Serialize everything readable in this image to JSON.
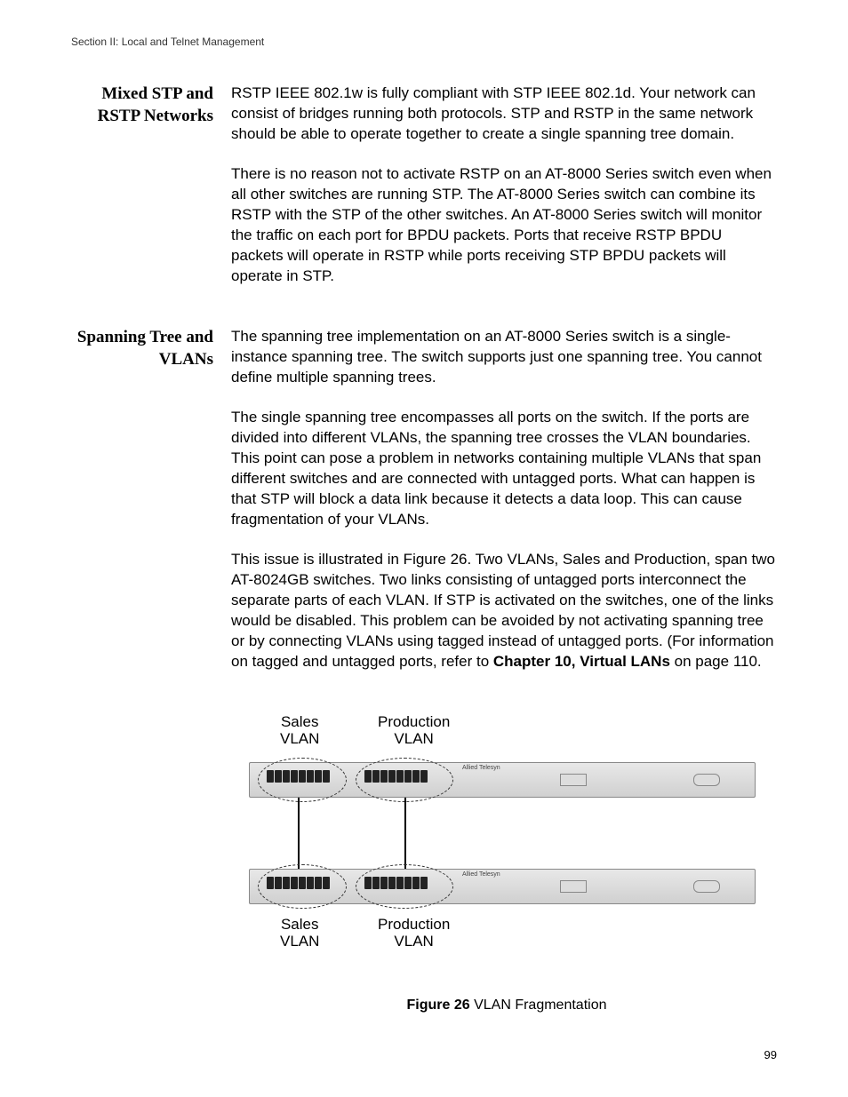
{
  "header": "Section II: Local and Telnet Management",
  "sections": [
    {
      "heading": "Mixed STP and RSTP Networks",
      "paragraphs": [
        "RSTP IEEE 802.1w is fully compliant with STP IEEE 802.1d. Your network can consist of bridges running both protocols. STP and RSTP in the same network should be able to operate together to create a single spanning tree domain.",
        "There is no reason not to activate RSTP on an AT-8000 Series switch even when all other switches are running STP. The AT-8000 Series switch can combine its RSTP with the STP of the other switches. An AT-8000 Series switch will monitor the traffic on each port for BPDU packets. Ports that receive RSTP BPDU packets will operate in RSTP while ports receiving STP BPDU packets will operate in STP."
      ]
    },
    {
      "heading": "Spanning Tree and VLANs",
      "paragraphs": [
        "The spanning tree implementation on an AT-8000 Series switch is a single-instance spanning tree. The switch supports just one spanning tree. You cannot define multiple spanning trees.",
        "The single spanning tree encompasses all ports on the switch. If the ports are divided into different VLANs, the spanning tree crosses the VLAN boundaries. This point can pose a problem in networks containing multiple VLANs that span different switches and are connected with untagged ports. What can happen is that STP will block a data link because it detects a data loop. This can cause fragmentation of your VLANs."
      ]
    }
  ],
  "para3_parts": {
    "pre": "This issue is illustrated in Figure 26. Two VLANs, Sales and Production, span two AT-8024GB switches. Two links consisting of untagged ports interconnect the separate parts of each VLAN. If STP is activated on the switches, one of the links would be disabled. This problem can be avoided by not activating spanning tree or by connecting VLANs using tagged instead of untagged ports. (For information on tagged and untagged ports, refer to ",
    "bold": "Chapter 10, Virtual LANs",
    "post": " on page 110."
  },
  "figure": {
    "labels": {
      "sales_top": "Sales",
      "vlan": "VLAN",
      "prod_top": "Production",
      "sales_bot": "Sales",
      "prod_bot": "Production"
    },
    "brand_text": "Allied Telesyn",
    "caption_bold": "Figure 26",
    "caption_rest": "  VLAN Fragmentation"
  },
  "page_number": "99"
}
